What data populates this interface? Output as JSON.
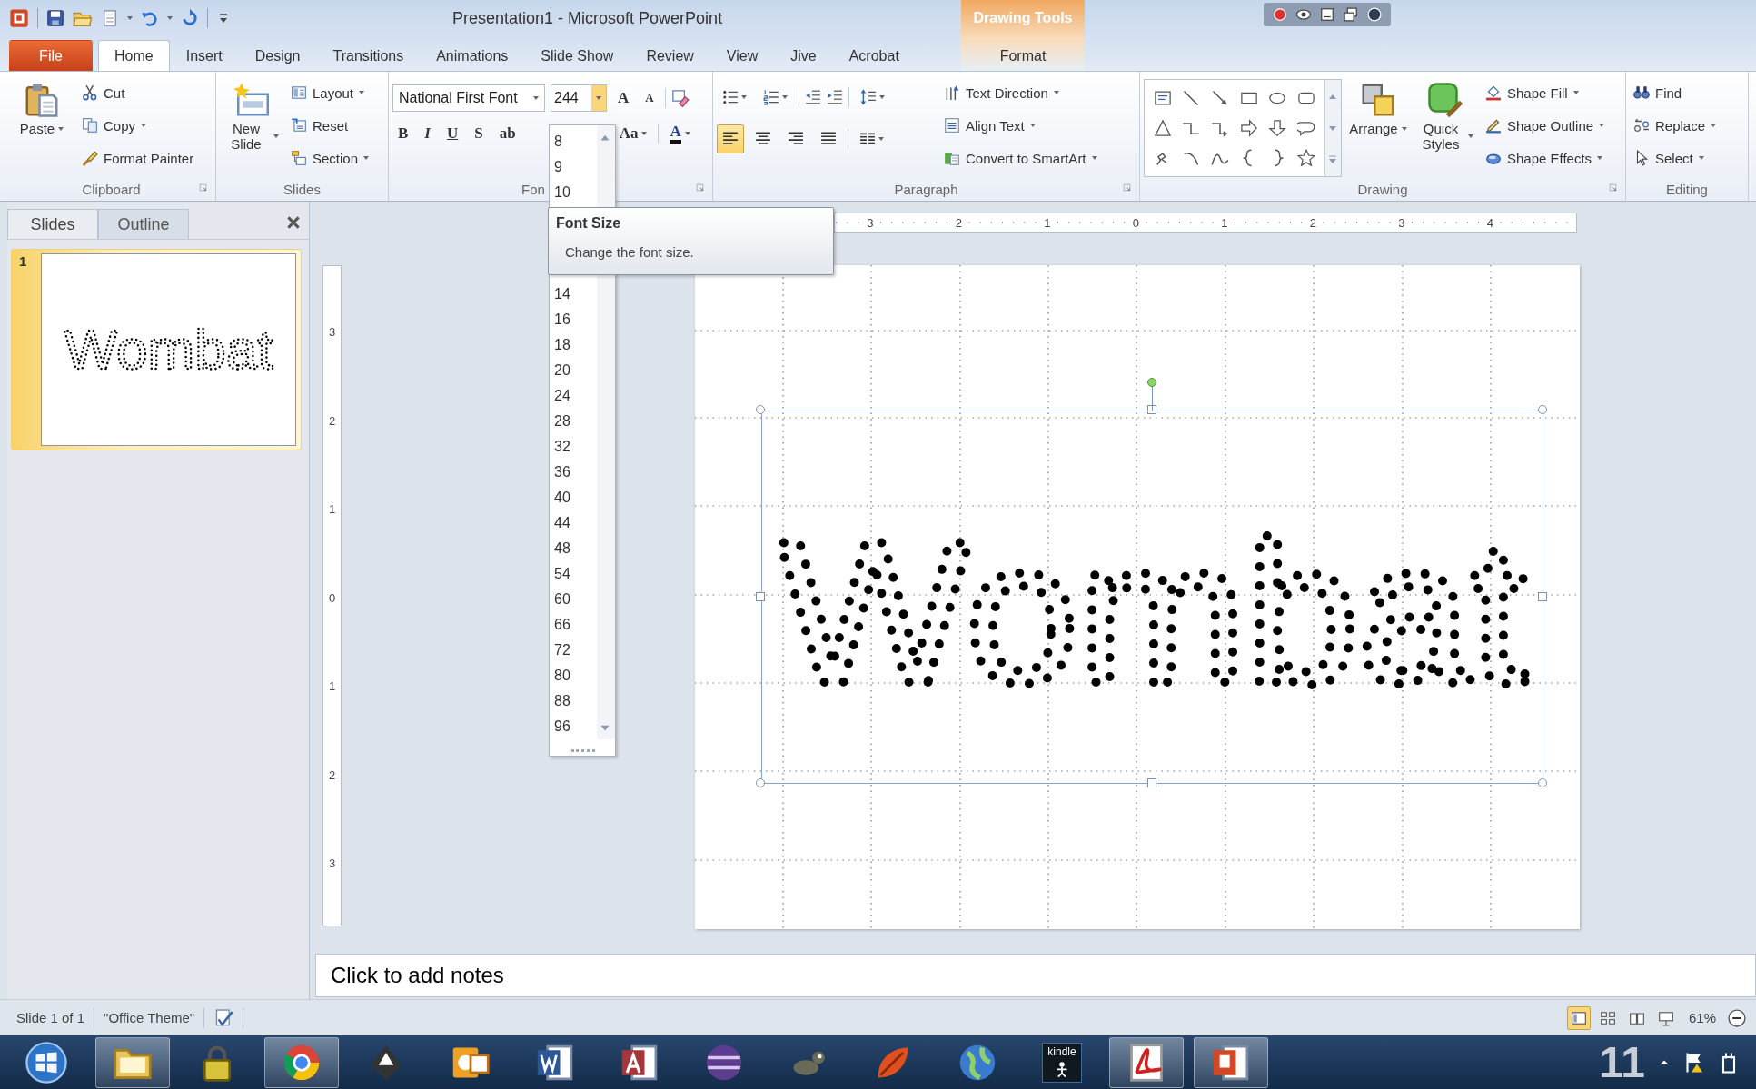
{
  "title_bar": {
    "title": "Presentation1 - Microsoft PowerPoint",
    "context_tab": "Drawing Tools"
  },
  "tabs": [
    {
      "label": "File",
      "kind": "file",
      "selected": false
    },
    {
      "label": "Home",
      "kind": "normal",
      "selected": true
    },
    {
      "label": "Insert",
      "kind": "normal",
      "selected": false
    },
    {
      "label": "Design",
      "kind": "normal",
      "selected": false
    },
    {
      "label": "Transitions",
      "kind": "normal",
      "selected": false
    },
    {
      "label": "Animations",
      "kind": "normal",
      "selected": false
    },
    {
      "label": "Slide Show",
      "kind": "normal",
      "selected": false
    },
    {
      "label": "Review",
      "kind": "normal",
      "selected": false
    },
    {
      "label": "View",
      "kind": "normal",
      "selected": false
    },
    {
      "label": "Jive",
      "kind": "normal",
      "selected": false
    },
    {
      "label": "Acrobat",
      "kind": "normal",
      "selected": false
    },
    {
      "label": "Format",
      "kind": "contextual",
      "selected": false
    }
  ],
  "ribbon": {
    "groups": [
      {
        "kind": "clipboard",
        "name": "Clipboard",
        "launcher": true,
        "large": {
          "label": "Paste",
          "dropdown": true
        },
        "small": [
          {
            "label": "Cut",
            "dropdown": false
          },
          {
            "label": "Copy",
            "dropdown": true
          },
          {
            "label": "Format Painter",
            "dropdown": false
          }
        ]
      },
      {
        "kind": "slides",
        "name": "Slides",
        "launcher": false,
        "large": {
          "label": "New Slide",
          "dropdown": true
        },
        "small": [
          {
            "label": "Layout",
            "dropdown": true
          },
          {
            "label": "Reset",
            "dropdown": false
          },
          {
            "label": "Section",
            "dropdown": true
          }
        ]
      },
      {
        "kind": "font",
        "name": "Fon",
        "launcher": true,
        "font_name": "National First Font",
        "font_size": "244",
        "grow": "A",
        "shrink": "A",
        "styles": [
          "B",
          "I",
          "U",
          "S",
          "ab"
        ],
        "change_case": "Aa",
        "font_color": "A"
      },
      {
        "kind": "paragraph",
        "name": "Paragraph",
        "launcher": true,
        "alignment": [
          {
            "selected": true
          },
          {
            "selected": false
          },
          {
            "selected": false
          },
          {
            "selected": false
          }
        ],
        "small": [
          {
            "label": "Text Direction",
            "dropdown": true
          },
          {
            "label": "Align Text",
            "dropdown": true
          },
          {
            "label": "Convert to SmartArt",
            "dropdown": true
          }
        ]
      },
      {
        "kind": "drawing",
        "name": "Drawing",
        "launcher": true,
        "large": [
          {
            "label": "Arrange",
            "dropdown": true
          },
          {
            "label": "Quick Styles",
            "dropdown": true
          }
        ],
        "small": [
          {
            "label": "Shape Fill",
            "dropdown": true
          },
          {
            "label": "Shape Outline",
            "dropdown": true
          },
          {
            "label": "Shape Effects",
            "dropdown": true
          }
        ]
      },
      {
        "kind": "editing",
        "name": "Editing",
        "launcher": false,
        "small": [
          {
            "label": "Find",
            "dropdown": false
          },
          {
            "label": "Replace",
            "dropdown": true
          },
          {
            "label": "Select",
            "dropdown": true
          }
        ]
      }
    ]
  },
  "font_size_menu": {
    "options": [
      "8",
      "9",
      "10",
      "14",
      "16",
      "18",
      "20",
      "24",
      "28",
      "32",
      "36",
      "40",
      "44",
      "48",
      "54",
      "60",
      "66",
      "72",
      "80",
      "88",
      "96"
    ]
  },
  "tooltip": {
    "title": "Font Size",
    "text": "Change the font size."
  },
  "slides_pane": {
    "tabs": [
      {
        "label": "Slides",
        "selected": true
      },
      {
        "label": "Outline",
        "selected": false
      }
    ],
    "slides": [
      {
        "number": "1",
        "text": "Wombat",
        "selected": true
      }
    ]
  },
  "rulers": {
    "horizontal": [
      "3",
      "2",
      "1",
      "0",
      "1",
      "2",
      "3",
      "4"
    ],
    "vertical": [
      "3",
      "2",
      "1",
      "0",
      "1",
      "2",
      "3"
    ]
  },
  "slide": {
    "text": "Wombat",
    "selected": true
  },
  "notes": {
    "placeholder": "Click to add notes"
  },
  "status_bar": {
    "slide": "Slide 1 of 1",
    "theme": "\"Office Theme\"",
    "views": [
      {
        "selected": true
      },
      {
        "selected": false
      },
      {
        "selected": false
      },
      {
        "selected": false
      }
    ],
    "zoom": "61%"
  },
  "taskbar": {
    "apps": [
      {
        "kind": "folder",
        "running": true
      },
      {
        "kind": "padlock",
        "running": false
      },
      {
        "kind": "browser",
        "running": true
      },
      {
        "kind": "inkblot",
        "running": false
      },
      {
        "kind": "mail",
        "running": false
      },
      {
        "kind": "document",
        "running": false
      },
      {
        "kind": "database",
        "running": false
      },
      {
        "kind": "sphere",
        "running": false
      },
      {
        "kind": "animal",
        "running": false
      },
      {
        "kind": "leaf",
        "running": false
      },
      {
        "kind": "globe",
        "running": false
      },
      {
        "kind": "kindle",
        "label": "kindle",
        "running": false
      },
      {
        "kind": "pdf",
        "running": true
      },
      {
        "kind": "slides",
        "running": true
      }
    ],
    "clock": "11"
  }
}
